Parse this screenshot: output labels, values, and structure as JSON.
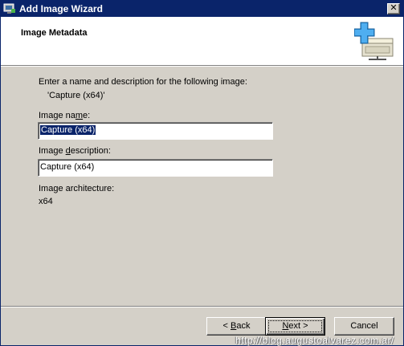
{
  "window": {
    "title": "Add Image Wizard",
    "close_glyph": "✕",
    "icons": {
      "title": "wizard-app-icon",
      "close": "close-icon",
      "header": "add-image-icon"
    },
    "colors": {
      "titlebar": "#0a246a",
      "dialog": "#d4d0c8",
      "selection": "#0a246a"
    }
  },
  "header": {
    "title": "Image Metadata"
  },
  "body": {
    "intro": "Enter a name and description for the following image:",
    "image_quoted": "'Capture (x64)'",
    "name_label": "Image name:",
    "name_value": "Capture (x64)",
    "description_label": "Image description:",
    "description_value": "Capture (x64)",
    "architecture_label": "Image architecture:",
    "architecture_value": "x64"
  },
  "footer": {
    "back_label": "< Back",
    "next_label": "Next >",
    "cancel_label": "Cancel"
  },
  "watermark": "http://blog.augustoalvarez.com.ar/"
}
